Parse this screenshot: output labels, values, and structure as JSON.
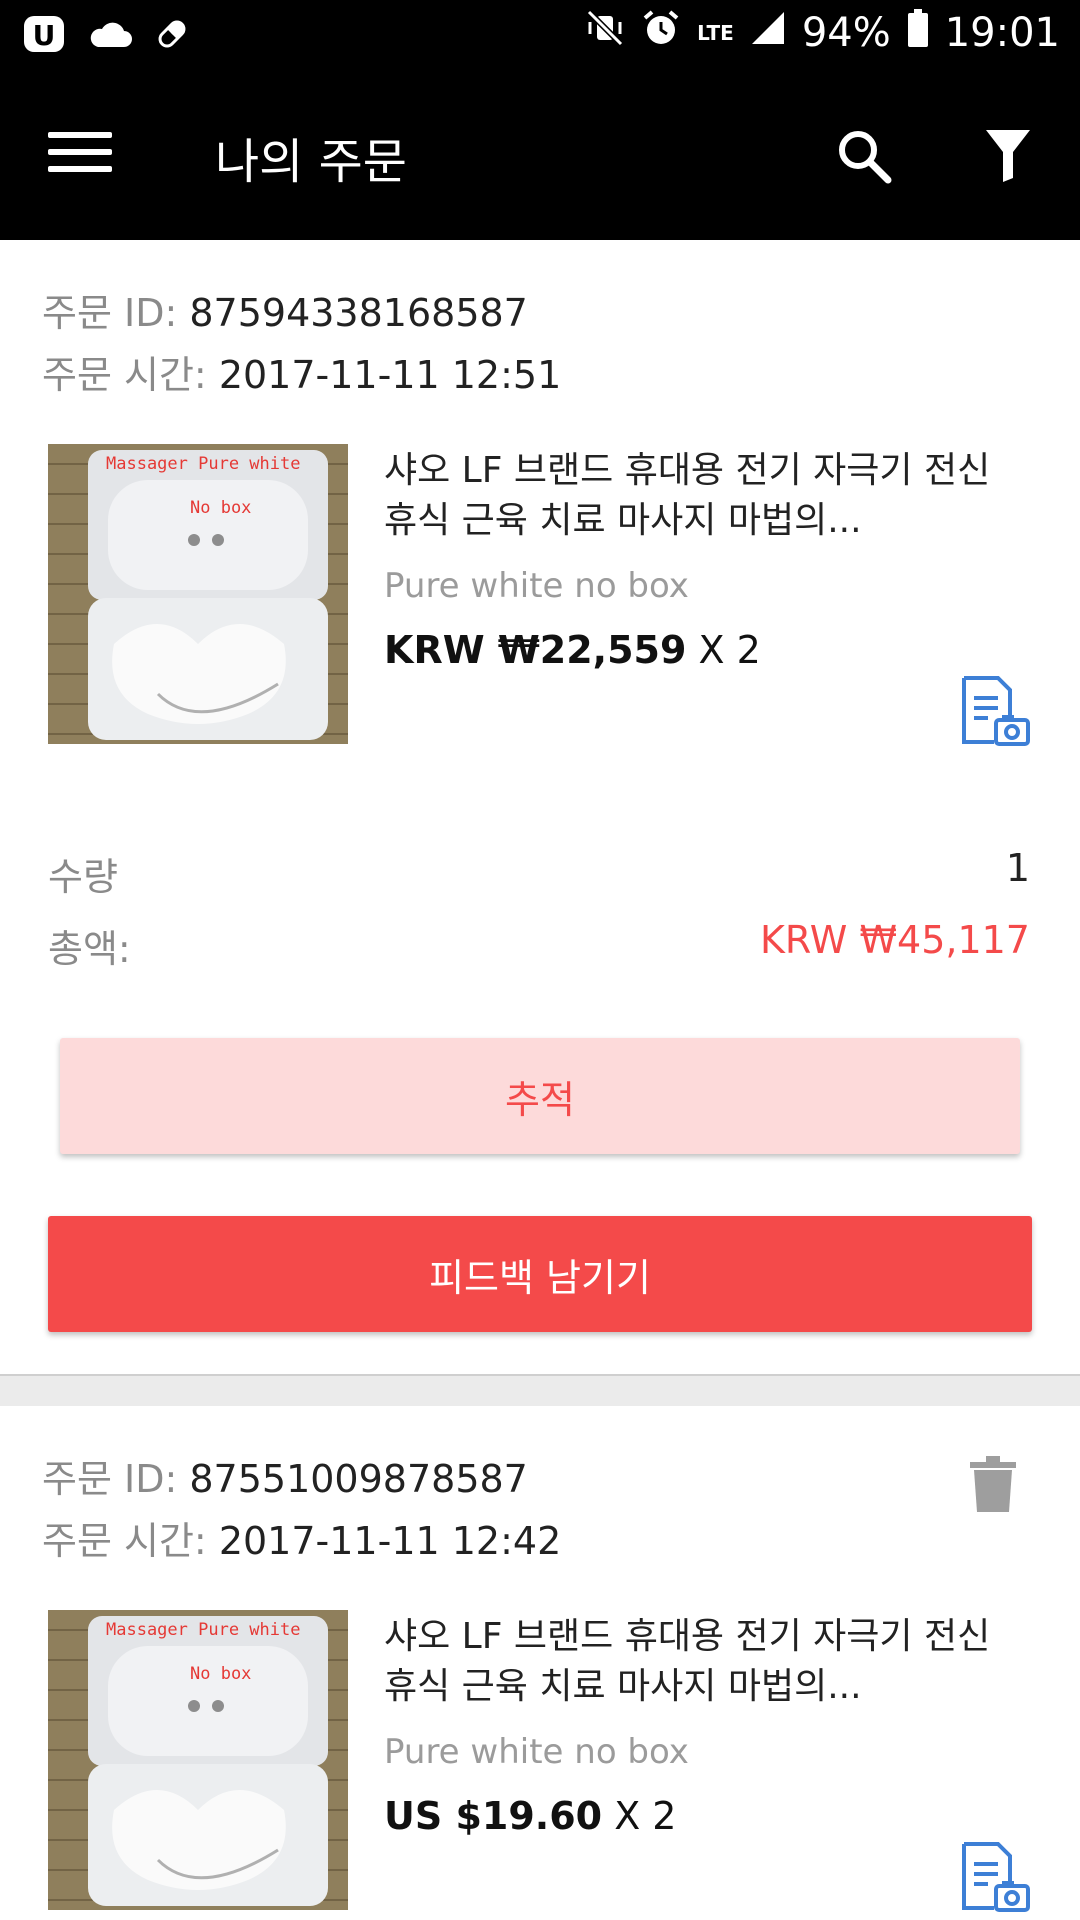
{
  "status_bar": {
    "battery": "94%",
    "time": "19:01",
    "network": "LTE",
    "left_icons": [
      "u-app-icon",
      "cloud-icon",
      "pill-icon"
    ],
    "right_icons": [
      "vibrate-mute-icon",
      "alarm-icon",
      "signal-icon",
      "battery-icon"
    ]
  },
  "toolbar": {
    "title": "나의 주문",
    "icons": [
      "menu-icon",
      "search-icon",
      "filter-icon"
    ]
  },
  "labels": {
    "order_id": "주문 ID:",
    "order_time": "주문 시간:",
    "quantity": "수량",
    "total": "총액:",
    "track_button": "추적",
    "feedback_button": "피드백 남기기"
  },
  "orders": [
    {
      "id": "87594338168587",
      "time": "2017-11-11 12:51",
      "product": {
        "title": "샤오 LF 브랜드 휴대용 전기 자극기 전신 휴식 근육 치료 마사지 마법의...",
        "variant": "Pure white no box",
        "price": "KRW ₩22,559",
        "qty_suffix": "X 2",
        "image_text": {
          "line1": "Massager Pure white",
          "line2": "No box"
        }
      },
      "quantity": "1",
      "total": "KRW ₩45,117"
    },
    {
      "id": "87551009878587",
      "time": "2017-11-11 12:42",
      "product": {
        "title": "샤오 LF 브랜드 휴대용 전기 자극기 전신 휴식 근육 치료 마사지 마법의...",
        "variant": "Pure white no box",
        "price": "US $19.60",
        "qty_suffix": "X 2",
        "image_text": {
          "line1": "Massager Pure white",
          "line2": "No box"
        }
      }
    }
  ],
  "colors": {
    "accent_red": "#f44a4a",
    "track_bg": "#fddada",
    "icon_blue": "#3d7fd6",
    "label_gray": "#8a8a8a"
  }
}
